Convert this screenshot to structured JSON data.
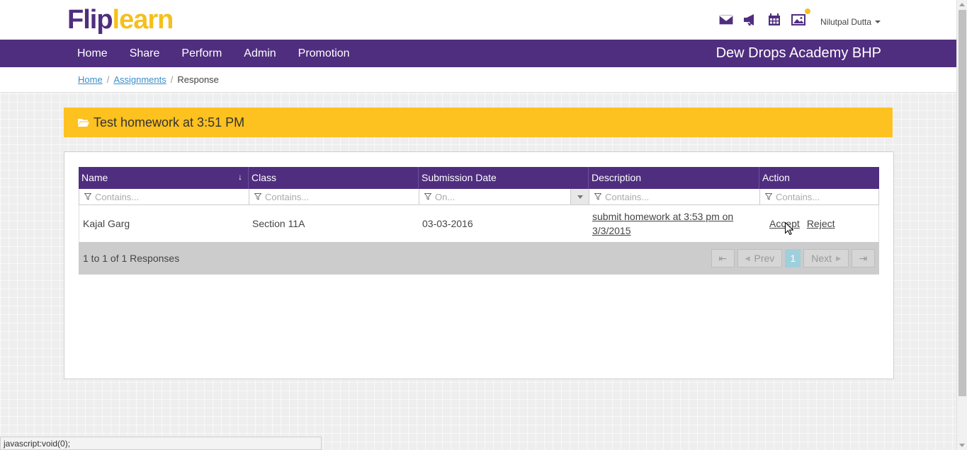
{
  "brand": {
    "logo_part1": "Flip",
    "logo_part2": "learn"
  },
  "header": {
    "icons": [
      "mail-icon",
      "megaphone-icon",
      "calendar-icon",
      "image-icon"
    ],
    "user_name": "Nilutpal Dutta"
  },
  "nav": {
    "items": [
      {
        "label": "Home"
      },
      {
        "label": "Share"
      },
      {
        "label": "Perform"
      },
      {
        "label": "Admin"
      },
      {
        "label": "Promotion"
      }
    ],
    "school_name": "Dew Drops Academy BHP"
  },
  "breadcrumb": {
    "home": "Home",
    "sep": "/",
    "assignments": "Assignments",
    "current": "Response"
  },
  "banner": {
    "title": "Test homework at 3:51 PM"
  },
  "grid": {
    "columns": [
      {
        "label": "Name",
        "filter_placeholder": "Contains..."
      },
      {
        "label": "Class",
        "filter_placeholder": "Contains..."
      },
      {
        "label": "Submission Date",
        "filter_placeholder": "On..."
      },
      {
        "label": "Description",
        "filter_placeholder": "Contains..."
      },
      {
        "label": "Action",
        "filter_placeholder": "Contains..."
      }
    ],
    "sort_indicator": "↓",
    "rows": [
      {
        "name": "Kajal Garg",
        "class": "Section 11A",
        "submission_date": "03-03-2016",
        "description": "submit homework at 3:53 pm on 3/3/2015",
        "accept": "Accept",
        "reject": "Reject"
      }
    ],
    "pager": {
      "info": "1 to 1 of 1 Responses",
      "first": "⇤",
      "prev": "Prev",
      "prev_arrow": "◀",
      "page": "1",
      "next": "Next",
      "next_arrow": "▶",
      "last": "⇥"
    }
  },
  "statusbar": {
    "text": "javascript:void(0);"
  },
  "colors": {
    "brand_purple": "#4f2d7f",
    "brand_yellow": "#fdc120",
    "active_page": "#9fcfdc"
  }
}
